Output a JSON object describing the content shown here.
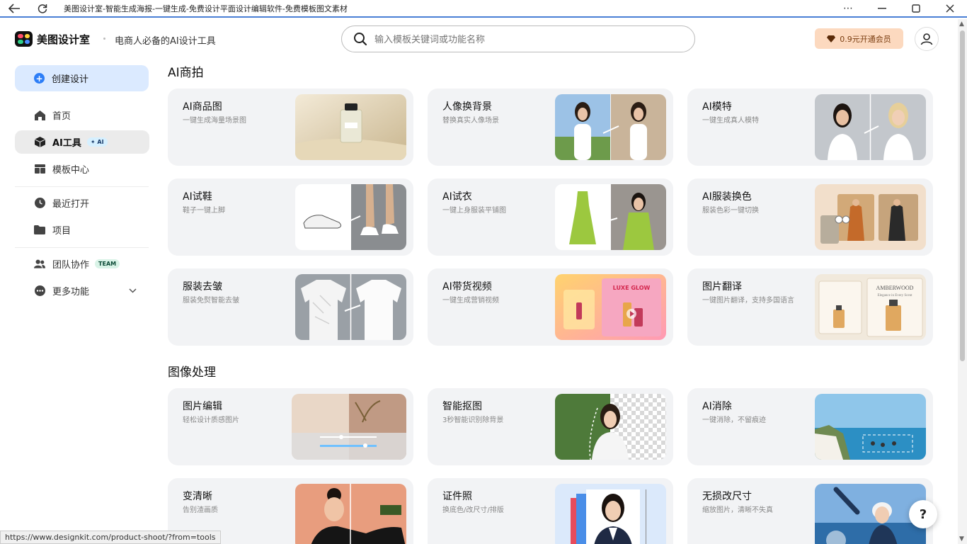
{
  "window": {
    "title": "美图设计室-智能生成海报-一键生成-免费设计平面设计编辑软件-免费模板图文素材"
  },
  "header": {
    "brand": "美图设计室",
    "slogan": "电商人必备的AI设计工具",
    "search_placeholder": "输入模板关键词或功能名称",
    "vip_label": "0.9元开通会员"
  },
  "sidebar": {
    "create_label": "创建设计",
    "items": [
      {
        "label": "首页",
        "icon": "home-icon"
      },
      {
        "label": "AI工具",
        "icon": "cube-icon",
        "badge": "✦ AI",
        "active": true
      },
      {
        "label": "模板中心",
        "icon": "template-icon"
      },
      {
        "label": "最近打开",
        "icon": "clock-icon"
      },
      {
        "label": "项目",
        "icon": "folder-icon"
      },
      {
        "label": "团队协作",
        "icon": "team-icon",
        "badge": "TEAM"
      },
      {
        "label": "更多功能",
        "icon": "more-icon"
      }
    ]
  },
  "sections": [
    {
      "title": "AI商拍",
      "cards": [
        {
          "title": "AI商品图",
          "desc": "一键生成海量场景图"
        },
        {
          "title": "人像换背景",
          "desc": "替换真实人像场景"
        },
        {
          "title": "AI模特",
          "desc": "一键生成真人模特"
        },
        {
          "title": "AI试鞋",
          "desc": "鞋子一键上脚"
        },
        {
          "title": "AI试衣",
          "desc": "一键上身服装平铺图"
        },
        {
          "title": "AI服装换色",
          "desc": "服装色彩一键切换"
        },
        {
          "title": "服装去皱",
          "desc": "服装免熨智能去皱"
        },
        {
          "title": "AI带货视频",
          "desc": "一键生成营销视频"
        },
        {
          "title": "图片翻译",
          "desc": "一键图片翻译，支持多国语言"
        }
      ]
    },
    {
      "title": "图像处理",
      "cards": [
        {
          "title": "图片编辑",
          "desc": "轻松设计质感图片"
        },
        {
          "title": "智能抠图",
          "desc": "3秒智能识别除背景"
        },
        {
          "title": "AI消除",
          "desc": "一键消除，不留痕迹"
        },
        {
          "title": "变清晰",
          "desc": "告别渣画质"
        },
        {
          "title": "证件照",
          "desc": "换底色/改尺寸/排版"
        },
        {
          "title": "无损改尺寸",
          "desc": "缩放图片，清晰不失真"
        }
      ]
    }
  ],
  "thumb_text": {
    "luxe_glow": "LUXE GLOW",
    "amberwood": "AMBERWOOD",
    "amberwood_sub": "Elegance in Every Scent"
  },
  "help_label": "?",
  "status_url": "https://www.designkit.com/product-shoot/?from=tools",
  "colors": {
    "accent": "#2d7ef7",
    "create_bg": "#dbeaff",
    "card_bg": "#f2f3f5",
    "vip_bg": "#fcd9bf"
  }
}
